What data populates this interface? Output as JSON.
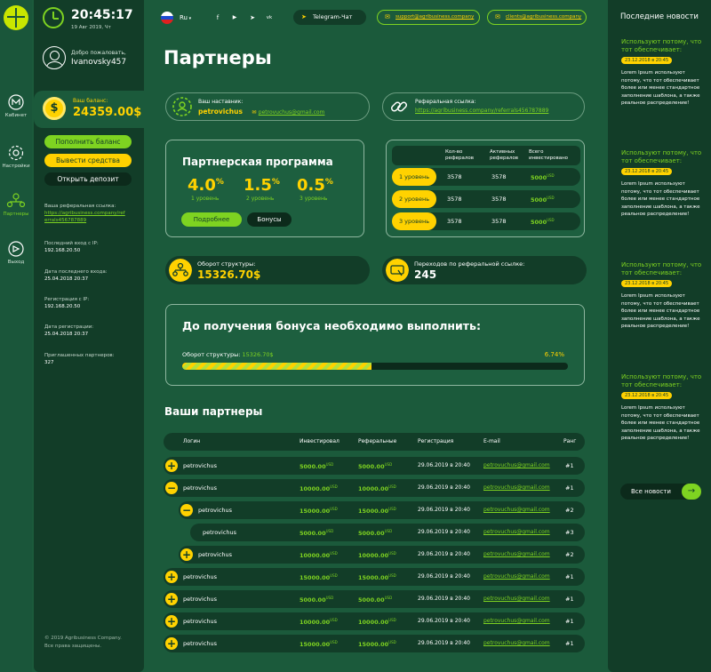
{
  "nav": {
    "items": [
      {
        "label": "Кабинет",
        "icon": "cabinet-icon"
      },
      {
        "label": "Настройки",
        "icon": "settings-icon"
      },
      {
        "label": "Партнеры",
        "icon": "partners-icon"
      },
      {
        "label": "Выход",
        "icon": "exit-icon"
      }
    ],
    "active": "Партнеры"
  },
  "clock": {
    "time": "20:45:17",
    "date": "19 Авг 2019, Чт"
  },
  "user": {
    "welcome": "Добро пожаловать,",
    "name": "Ivanovsky457"
  },
  "balance": {
    "label": "Ваш баланс:",
    "value": "24359.00$"
  },
  "actions": {
    "topup": "Пополнить баланс",
    "withdraw": "Вывести средства",
    "deposit": "Открыть депозит"
  },
  "info": {
    "ref_label": "Ваша реферальная ссылка:",
    "ref_link": "https://agribusiness.company/referrals456787889",
    "last_ip_label": "Последний вход с IP:",
    "last_ip": "192.168.20.50",
    "last_date_label": "Дата последнего входа:",
    "last_date": "25.04.2018  20:37",
    "reg_ip_label": "Регистрация с IP:",
    "reg_ip": "192.168.20.50",
    "reg_date_label": "Дата регистрации:",
    "reg_date": "25.04.2018  20:37",
    "invited_label": "Приглашенных партнеров:",
    "invited": "327"
  },
  "footer": {
    "line1": "© 2019  Agribusiness Company.",
    "line2": "Все права защищены."
  },
  "topbar": {
    "lang": "Ru",
    "socials": [
      "f",
      "▶",
      "➤",
      "vk"
    ],
    "telegram": "Telegram-Чат",
    "email_support": "support@agribusiness.company",
    "email_clients": "clients@agribusiness.company"
  },
  "page": {
    "title": "Партнеры"
  },
  "mentor": {
    "label": "Ваш наставник:",
    "name": "petrovichus",
    "email": "petrovuchus@gmail.com"
  },
  "referral": {
    "label": "Реферальная ссылка:",
    "link": "https://agribusiness.company/referrals456787889"
  },
  "program": {
    "title": "Партнерская программа",
    "levels": [
      {
        "pct": "4.0",
        "label": "1 уровень"
      },
      {
        "pct": "1.5",
        "label": "2 уровень"
      },
      {
        "pct": "0.5",
        "label": "3 уровень"
      }
    ],
    "more": "Подробнее",
    "bonuses": "Бонусы"
  },
  "level_table": {
    "headers": [
      "Кол-во рефералов",
      "Активных рефералов",
      "Всего инвестировано"
    ],
    "rows": [
      {
        "level": "1 уровень",
        "count": "3578",
        "active": "3578",
        "total": "5000",
        "unit": "USD"
      },
      {
        "level": "2 уровень",
        "count": "3578",
        "active": "3578",
        "total": "5000",
        "unit": "USD"
      },
      {
        "level": "3 уровень",
        "count": "3578",
        "active": "3578",
        "total": "5000",
        "unit": "USD"
      }
    ]
  },
  "turnover": {
    "label": "Оборот структуры:",
    "value": "15326.70$"
  },
  "clicks": {
    "label": "Переходов по реферальной ссылке:",
    "value": "245"
  },
  "goal": {
    "title": "До получения бонуса необходимо выполнить:",
    "label": "Оборот структуры:",
    "value": "15326.70$",
    "percent": "6.74%",
    "progress": 0.49
  },
  "partners": {
    "title": "Ваши партнеры",
    "headers": [
      "Логин",
      "Инвестировал",
      "Реферальные",
      "Регистрация",
      "E-mail",
      "Ранг"
    ],
    "rows": [
      {
        "toggle": "+",
        "level": 0,
        "login": "petrovichus",
        "invested": "5000.00",
        "referral": "5000.00",
        "unit": "USD",
        "reg": "29.06.2019 в 20:40",
        "email": "petrovuchus@gmail.com",
        "rank": "#1"
      },
      {
        "toggle": "−",
        "level": 0,
        "login": "petrovichus",
        "invested": "10000.00",
        "referral": "10000.00",
        "unit": "USD",
        "reg": "29.06.2019 в 20:40",
        "email": "petrovuchus@gmail.com",
        "rank": "#1"
      },
      {
        "toggle": "−",
        "level": 1,
        "login": "petrovichus",
        "invested": "15000.00",
        "referral": "15000.00",
        "unit": "USD",
        "reg": "29.06.2019 в 20:40",
        "email": "petrovuchus@gmail.com",
        "rank": "#2"
      },
      {
        "toggle": "",
        "level": 2,
        "login": "petrovichus",
        "invested": "5000.00",
        "referral": "5000.00",
        "unit": "USD",
        "reg": "29.06.2019 в 20:40",
        "email": "petrovuchus@gmail.com",
        "rank": "#3"
      },
      {
        "toggle": "+",
        "level": 1,
        "login": "petrovichus",
        "invested": "10000.00",
        "referral": "10000.00",
        "unit": "USD",
        "reg": "29.06.2019 в 20:40",
        "email": "petrovuchus@gmail.com",
        "rank": "#2"
      },
      {
        "toggle": "+",
        "level": 0,
        "login": "petrovichus",
        "invested": "15000.00",
        "referral": "15000.00",
        "unit": "USD",
        "reg": "29.06.2019 в 20:40",
        "email": "petrovuchus@gmail.com",
        "rank": "#1"
      },
      {
        "toggle": "+",
        "level": 0,
        "login": "petrovichus",
        "invested": "5000.00",
        "referral": "5000.00",
        "unit": "USD",
        "reg": "29.06.2019 в 20:40",
        "email": "petrovuchus@gmail.com",
        "rank": "#1"
      },
      {
        "toggle": "+",
        "level": 0,
        "login": "petrovichus",
        "invested": "10000.00",
        "referral": "10000.00",
        "unit": "USD",
        "reg": "29.06.2019 в 20:40",
        "email": "petrovuchus@gmail.com",
        "rank": "#1"
      },
      {
        "toggle": "+",
        "level": 0,
        "login": "petrovichus",
        "invested": "15000.00",
        "referral": "15000.00",
        "unit": "USD",
        "reg": "29.06.2019 в 20:40",
        "email": "petrovuchus@gmail.com",
        "rank": "#1"
      }
    ]
  },
  "news": {
    "title": "Последние новости",
    "items": [
      {
        "headline": "Используют потому, что тот обеспечивает:",
        "date": "23.12.2018 в 20:45",
        "text": "Lorem Ipsum используют потому, что тот обеспечивает более или менее стандартное заполнение шаблона, а также реальное распределение!"
      },
      {
        "headline": "Используют потому, что тот обеспечивает:",
        "date": "23.12.2018 в 20:45",
        "text": "Lorem Ipsum используют потому, что тот обеспечивает более или менее стандартное заполнение шаблона, а также реальное распределение!"
      },
      {
        "headline": "Используют потому, что тот обеспечивает:",
        "date": "23.12.2018 в 20:45",
        "text": "Lorem Ipsum используют потому, что тот обеспечивает более или менее стандартное заполнение шаблона, а также реальное распределение!"
      },
      {
        "headline": "Используют потому, что тот обеспечивает:",
        "date": "23.12.2018 в 20:45",
        "text": "Lorem Ipsum используют потому, что тот обеспечивает более или менее стандартное заполнение шаблона, а также реальное распределение!"
      }
    ],
    "all": "Все новости"
  },
  "colors": {
    "bg": "#1b5a3b",
    "panel": "#123d28",
    "accent_green": "#7ed321",
    "accent_yellow": "#ffd200"
  }
}
